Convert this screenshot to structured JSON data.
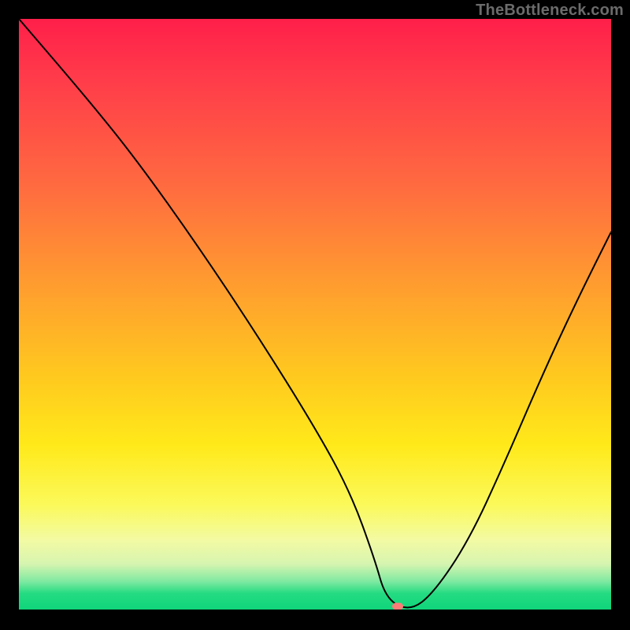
{
  "watermark": "TheBottleneck.com",
  "marker": {
    "x_pct": 64,
    "y_pct": 99.2
  },
  "chart_data": {
    "type": "line",
    "title": "",
    "xlabel": "",
    "ylabel": "",
    "xlim": [
      0,
      100
    ],
    "ylim": [
      0,
      100
    ],
    "series": [
      {
        "name": "bottleneck-curve",
        "x": [
          0,
          12,
          20,
          30,
          40,
          50,
          56,
          60,
          62,
          66,
          70,
          76,
          82,
          88,
          94,
          100
        ],
        "values": [
          100,
          86,
          76,
          62,
          47,
          31,
          20,
          9,
          2,
          0,
          3,
          12,
          25,
          39,
          52,
          64
        ]
      }
    ],
    "marker_point": {
      "x": 64,
      "y": 0.8
    },
    "gradient_stops": [
      {
        "pct": 0,
        "color": "#ff1f4a"
      },
      {
        "pct": 10,
        "color": "#ff3b4a"
      },
      {
        "pct": 28,
        "color": "#ff6a40"
      },
      {
        "pct": 44,
        "color": "#ff9a30"
      },
      {
        "pct": 60,
        "color": "#ffc81f"
      },
      {
        "pct": 72,
        "color": "#ffe91a"
      },
      {
        "pct": 82,
        "color": "#fbf95a"
      },
      {
        "pct": 88,
        "color": "#f3faa3"
      },
      {
        "pct": 92,
        "color": "#d7f5b0"
      },
      {
        "pct": 95,
        "color": "#7fe9a1"
      },
      {
        "pct": 97,
        "color": "#24db82"
      },
      {
        "pct": 100,
        "color": "#0ed47a"
      }
    ]
  }
}
